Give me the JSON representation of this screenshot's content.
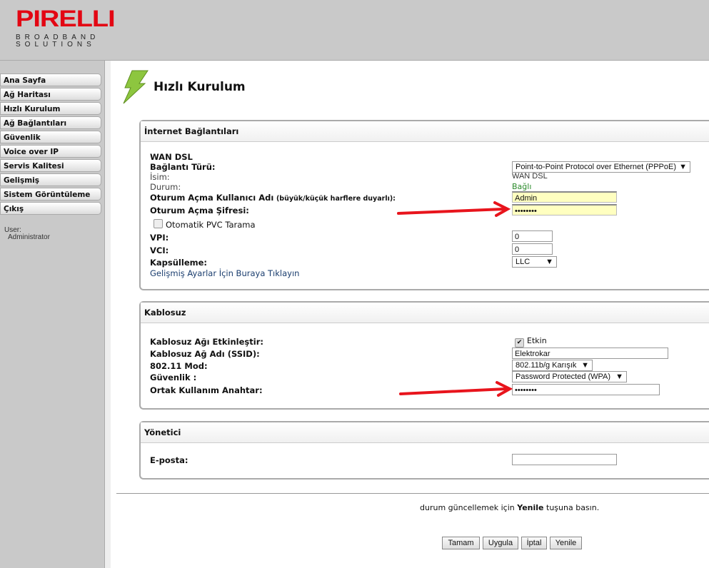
{
  "header": {
    "brand": "PIRELLI",
    "tagline1": "BROADBAND",
    "tagline2": "SOLUTIONS"
  },
  "sidebar": {
    "items": [
      {
        "label": "Ana Sayfa"
      },
      {
        "label": "Ağ Haritası"
      },
      {
        "label": "Hızlı Kurulum"
      },
      {
        "label": "Ağ Bağlantıları"
      },
      {
        "label": "Güvenlik"
      },
      {
        "label": "Voice over IP"
      },
      {
        "label": "Servis Kalitesi"
      },
      {
        "label": "Gelişmiş"
      },
      {
        "label": "Sistem Görüntüleme"
      },
      {
        "label": "Çıkış"
      }
    ],
    "user_label": "User:",
    "user_name": "Administrator"
  },
  "page": {
    "title": "Hızlı Kurulum"
  },
  "internet": {
    "title": "İnternet Bağlantıları",
    "wan": "WAN DSL",
    "conn_type_label": "Bağlantı Türü:",
    "conn_type_value": "Point-to-Point Protocol over Ethernet (PPPoE)",
    "name_label": "İsim:",
    "name_value": "WAN DSL",
    "status_label": "Durum:",
    "status_value": "Bağlı",
    "user_label": "Oturum Açma Kullanıcı Adı",
    "user_hint": "(büyük/küçük harflere duyarlı):",
    "user_value": "Admin",
    "pass_label": "Oturum Açma Şifresi:",
    "pass_value": "••••••••",
    "pvc_label": "Otomatik PVC Tarama",
    "vpi_label": "VPI:",
    "vpi_value": "0",
    "vci_label": "VCI:",
    "vci_value": "0",
    "encap_label": "Kapsülleme:",
    "encap_value": "LLC",
    "advanced_link": "Gelişmiş Ayarlar İçin Buraya Tıklayın"
  },
  "wireless": {
    "title": "Kablosuz",
    "enable_label": "Kablosuz Ağı Etkinleştir:",
    "enable_value": "Etkin",
    "ssid_label": "Kablosuz Ağ Adı (SSID):",
    "ssid_value": "Elektrokar",
    "mode_label": "802.11 Mod:",
    "mode_value": "802.11b/g Karışık",
    "security_label": "Güvenlik :",
    "security_value": "Password Protected (WPA)",
    "key_label": "Ortak Kullanım Anahtar:",
    "key_value": "••••••••"
  },
  "admin": {
    "title": "Yönetici",
    "email_label": "E-posta:",
    "email_value": ""
  },
  "footer": {
    "hint_pre": "durum güncellemek için ",
    "hint_bold": "Yenile",
    "hint_post": " tuşuna basın.",
    "buttons": {
      "ok": "Tamam",
      "apply": "Uygula",
      "cancel": "İptal",
      "refresh": "Yenile"
    }
  },
  "colors": {
    "brand": "#e30613",
    "status_ok": "#2a8a2a",
    "arrow": "#e8141c"
  }
}
